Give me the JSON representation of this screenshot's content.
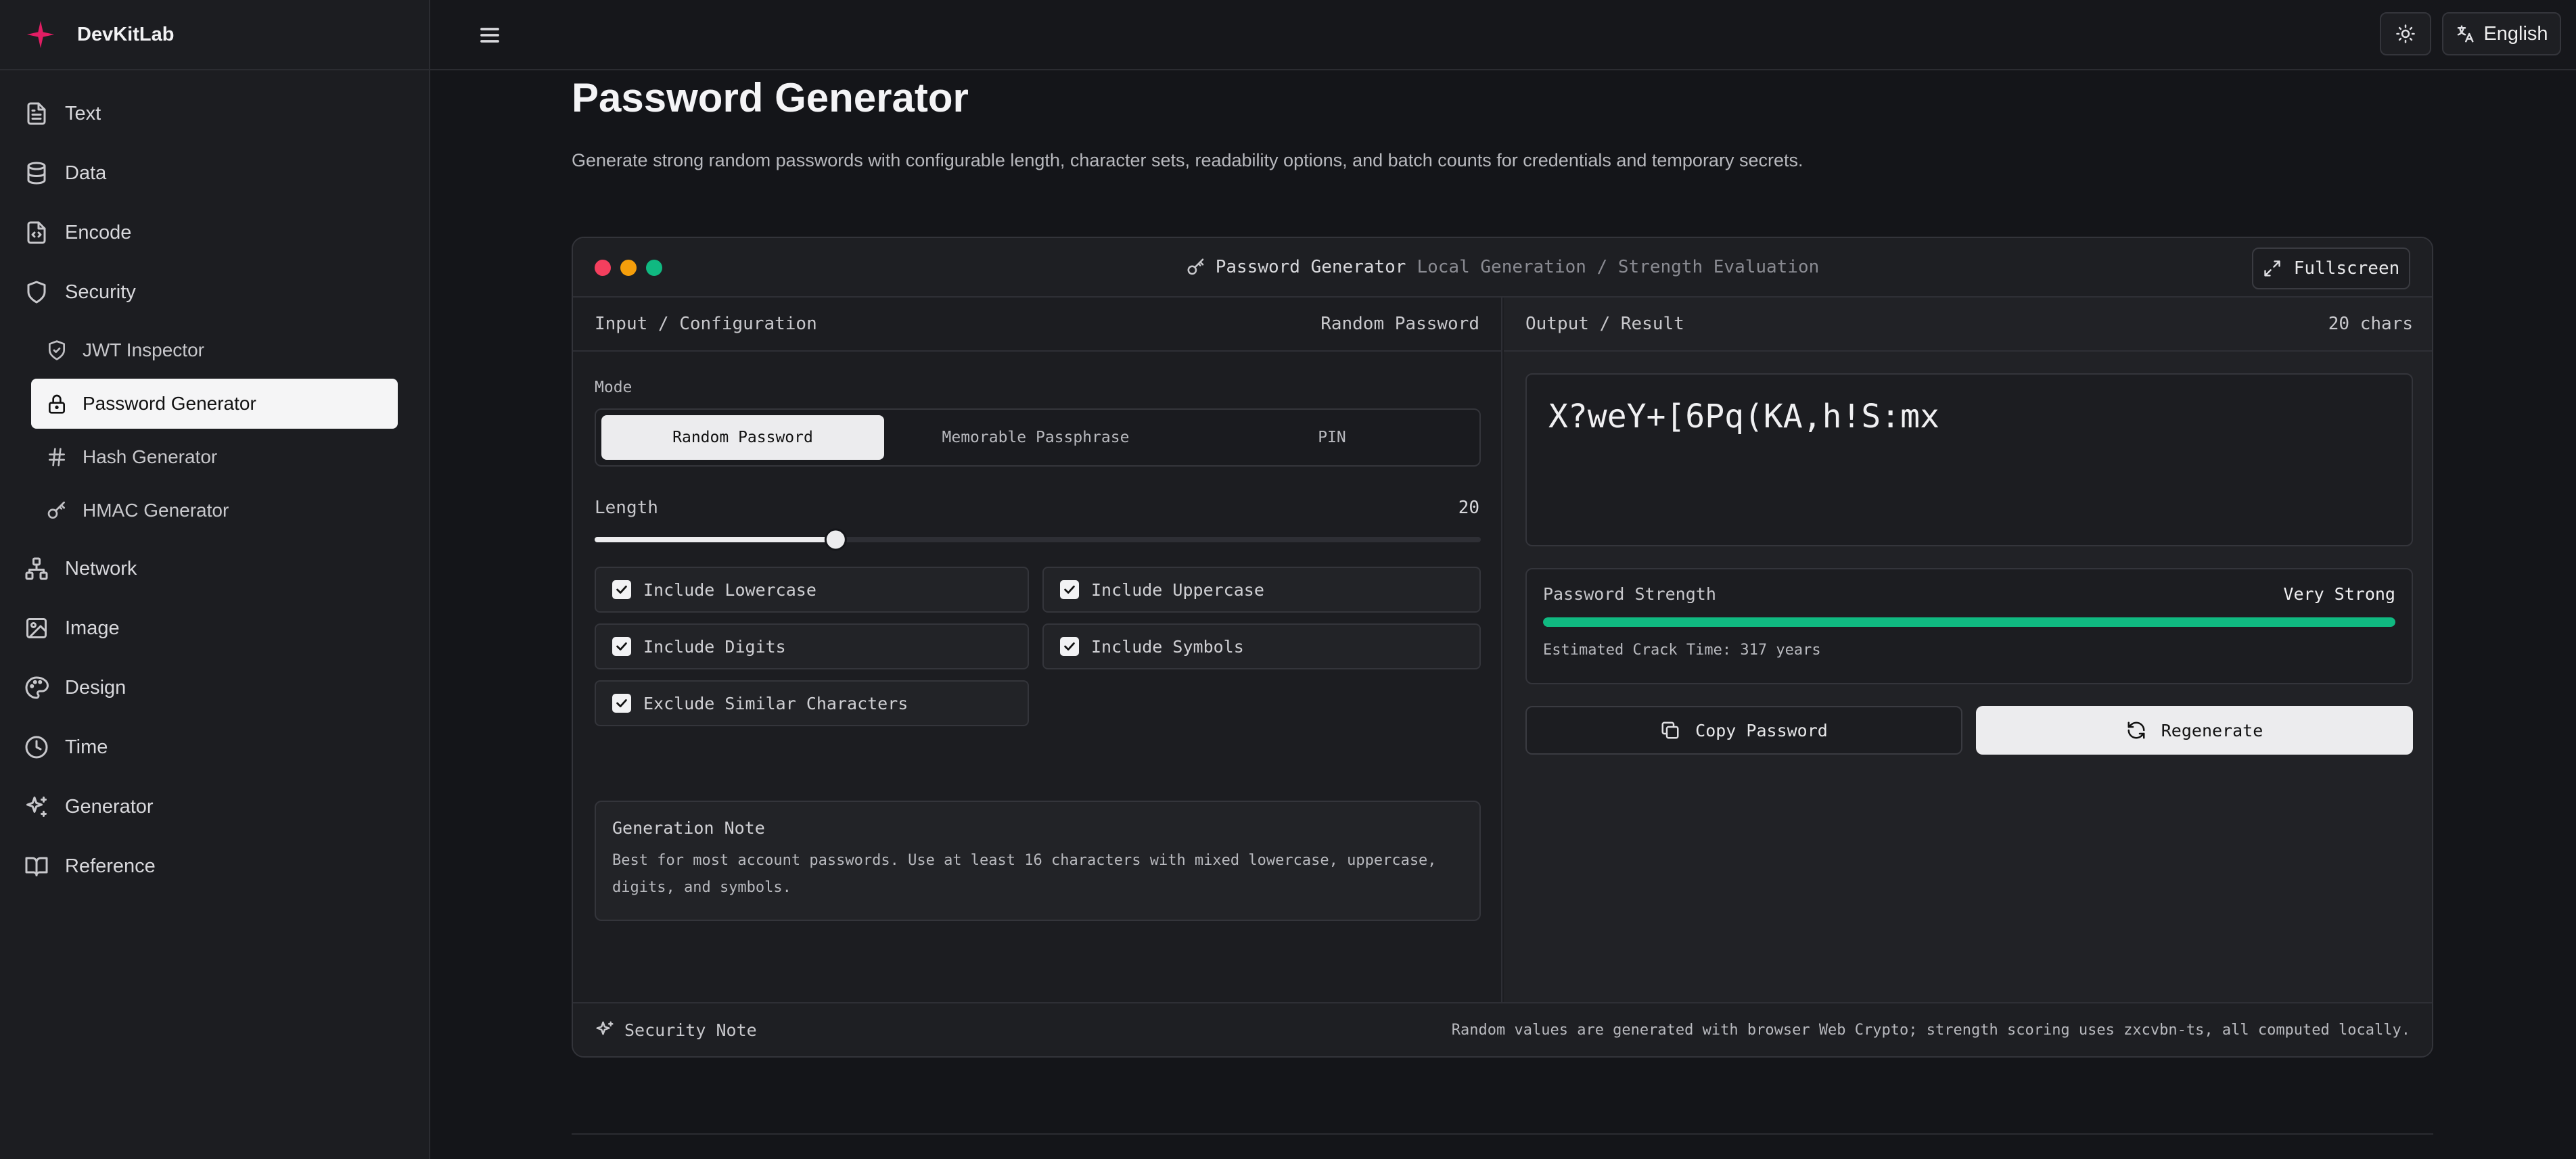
{
  "app": {
    "name": "DevKitLab",
    "accent": "#e11d63"
  },
  "sidebar": {
    "items": [
      {
        "label": "Text",
        "icon": "file-text-icon"
      },
      {
        "label": "Data",
        "icon": "database-icon"
      },
      {
        "label": "Encode",
        "icon": "file-code-icon"
      },
      {
        "label": "Security",
        "icon": "shield-icon"
      }
    ],
    "sub_items": [
      {
        "label": "JWT Inspector",
        "icon": "shield-check-icon"
      },
      {
        "label": "Password Generator",
        "icon": "lock-icon",
        "active": true
      },
      {
        "label": "Hash Generator",
        "icon": "hash-icon"
      },
      {
        "label": "HMAC Generator",
        "icon": "key-icon"
      }
    ],
    "items_after": [
      {
        "label": "Network",
        "icon": "network-icon"
      },
      {
        "label": "Image",
        "icon": "image-icon"
      },
      {
        "label": "Design",
        "icon": "palette-icon"
      },
      {
        "label": "Time",
        "icon": "clock-icon"
      },
      {
        "label": "Generator",
        "icon": "sparkles-icon"
      },
      {
        "label": "Reference",
        "icon": "book-icon"
      }
    ]
  },
  "topbar": {
    "language": "English",
    "theme_icon": "sun-icon",
    "menu_icon": "menu-icon"
  },
  "page": {
    "title": "Password Generator",
    "description": "Generate strong random passwords with configurable length, character sets, readability options, and batch counts for credentials and temporary secrets."
  },
  "card": {
    "title": "Password Generator",
    "subtitle": "Local Generation / Strength Evaluation",
    "fullscreen_label": "Fullscreen",
    "window_dots": [
      "#f43f5e",
      "#f59e0b",
      "#10b981"
    ]
  },
  "input": {
    "header": "Input / Configuration",
    "header_right": "Random Password",
    "mode_label": "Mode",
    "modes": [
      "Random Password",
      "Memorable Passphrase",
      "PIN"
    ],
    "active_mode": 0,
    "length_label": "Length",
    "length_value": "20",
    "length_min": 4,
    "length_max": 64,
    "options": [
      {
        "label": "Include Lowercase",
        "checked": true
      },
      {
        "label": "Include Uppercase",
        "checked": true
      },
      {
        "label": "Include Digits",
        "checked": true
      },
      {
        "label": "Include Symbols",
        "checked": true
      },
      {
        "label": "Exclude Similar Characters",
        "checked": true
      }
    ],
    "note_title": "Generation Note",
    "note_body": "Best for most account passwords. Use at least 16 characters with mixed lowercase, uppercase, digits, and symbols."
  },
  "output": {
    "header": "Output / Result",
    "header_right": "20 chars",
    "password": "X?weY+[6Pq(KA,h!S:mx",
    "strength_label": "Password Strength",
    "strength_value": "Very Strong",
    "strength_fraction": 1.0,
    "strength_color": "#10b981",
    "crack_time": "Estimated Crack Time: 317 years",
    "copy_label": "Copy Password",
    "regenerate_label": "Regenerate"
  },
  "footer": {
    "label": "Security Note",
    "text": "Random values are generated with browser Web Crypto; strength scoring uses zxcvbn-ts, all computed locally."
  }
}
